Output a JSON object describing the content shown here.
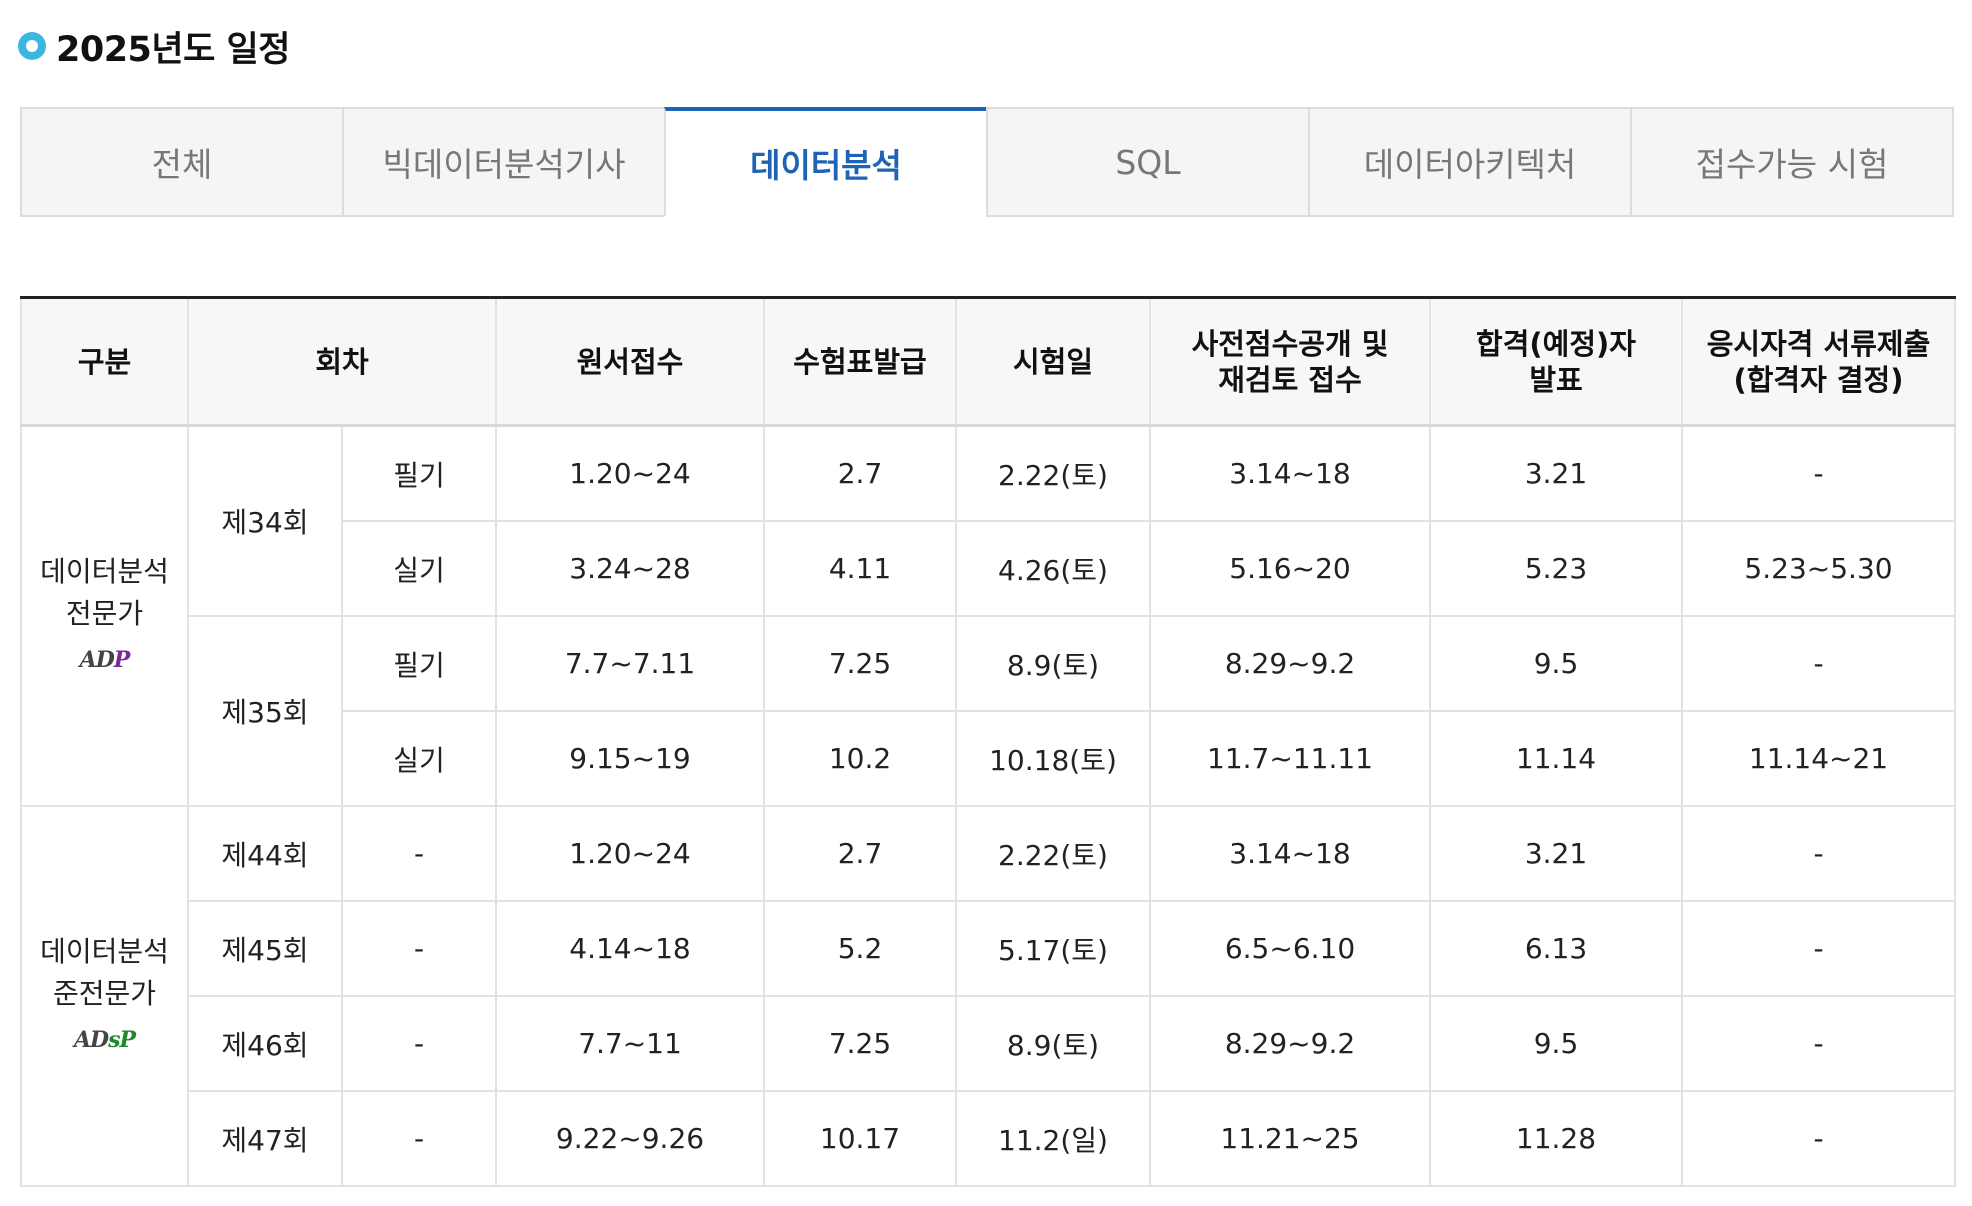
{
  "heading": {
    "title": "2025년도 일정"
  },
  "tabs": [
    {
      "label": "전체",
      "active": false
    },
    {
      "label": "빅데이터분석기사",
      "active": false
    },
    {
      "label": "데이터분석",
      "active": true
    },
    {
      "label": "SQL",
      "active": false
    },
    {
      "label": "데이터아키텍처",
      "active": false
    },
    {
      "label": "접수가능 시험",
      "active": false
    }
  ],
  "table": {
    "headers": {
      "category": "구분",
      "round": "회차",
      "application": "원서접수",
      "ticket": "수험표발급",
      "exam_date": "시험일",
      "preview": "사전점수공개 및 재검토 접수",
      "announce": "합격(예정)자 발표",
      "documents": "응시자격 서류제출 (합격자 결정)"
    },
    "adp": {
      "category": "데이터분석 전문가",
      "logo_a": "ADP",
      "round1": "제34회",
      "round2": "제35회",
      "rows": [
        {
          "type": "필기",
          "application": "1.20~24",
          "ticket": "2.7",
          "exam": "2.22(토)",
          "preview": "3.14~18",
          "announce": "3.21",
          "documents": "-"
        },
        {
          "type": "실기",
          "application": "3.24~28",
          "ticket": "4.11",
          "exam": "4.26(토)",
          "preview": "5.16~20",
          "announce": "5.23",
          "documents": "5.23~5.30"
        },
        {
          "type": "필기",
          "application": "7.7~7.11",
          "ticket": "7.25",
          "exam": "8.9(토)",
          "preview": "8.29~9.2",
          "announce": "9.5",
          "documents": "-"
        },
        {
          "type": "실기",
          "application": "9.15~19",
          "ticket": "10.2",
          "exam": "10.18(토)",
          "preview": "11.7~11.11",
          "announce": "11.14",
          "documents": "11.14~21"
        }
      ]
    },
    "adsp": {
      "category": "데이터분석 준전문가",
      "logo_a": "ADsP",
      "rows": [
        {
          "round": "제44회",
          "type": "-",
          "application": "1.20~24",
          "ticket": "2.7",
          "exam": "2.22(토)",
          "preview": "3.14~18",
          "announce": "3.21",
          "documents": "-"
        },
        {
          "round": "제45회",
          "type": "-",
          "application": "4.14~18",
          "ticket": "5.2",
          "exam": "5.17(토)",
          "preview": "6.5~6.10",
          "announce": "6.13",
          "documents": "-"
        },
        {
          "round": "제46회",
          "type": "-",
          "application": "7.7~11",
          "ticket": "7.25",
          "exam": "8.9(토)",
          "preview": "8.29~9.2",
          "announce": "9.5",
          "documents": "-"
        },
        {
          "round": "제47회",
          "type": "-",
          "application": "9.22~9.26",
          "ticket": "10.17",
          "exam": "11.2(일)",
          "preview": "11.21~25",
          "announce": "11.28",
          "documents": "-"
        }
      ]
    }
  },
  "colors": {
    "accent": "#1e63b6",
    "bullet": "#3bb8e0",
    "adp_logo": "#7a2a98",
    "adsp_logo": "#1a8a2a"
  }
}
